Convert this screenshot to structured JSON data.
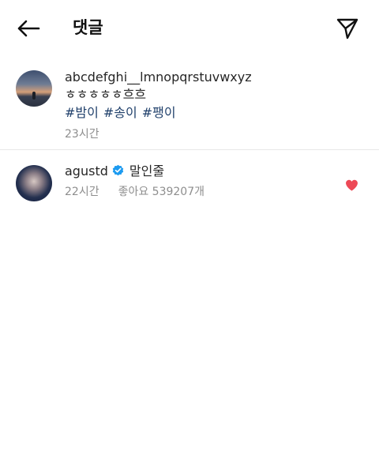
{
  "header": {
    "title": "댓글",
    "back_icon": "arrow-left-icon",
    "send_icon": "paper-plane-icon"
  },
  "caption": {
    "username": "abcdefghi__lmnopqrstuvwxyz",
    "text": "ㅎㅎㅎㅎㅎ흐흐",
    "hashtags": [
      "#밤이",
      "#송이",
      "#팽이"
    ],
    "time": "23시간"
  },
  "comment": {
    "username": "agustd",
    "verified_icon": "verified-badge-icon",
    "text": "말인줄",
    "time": "22시간",
    "likes": "좋아요 539207개",
    "heart_icon": "heart-filled-icon"
  },
  "colors": {
    "hashtag": "#20406b",
    "verified": "#1d9bf0",
    "heart": "#ed4956",
    "meta": "#8e8e8e"
  }
}
